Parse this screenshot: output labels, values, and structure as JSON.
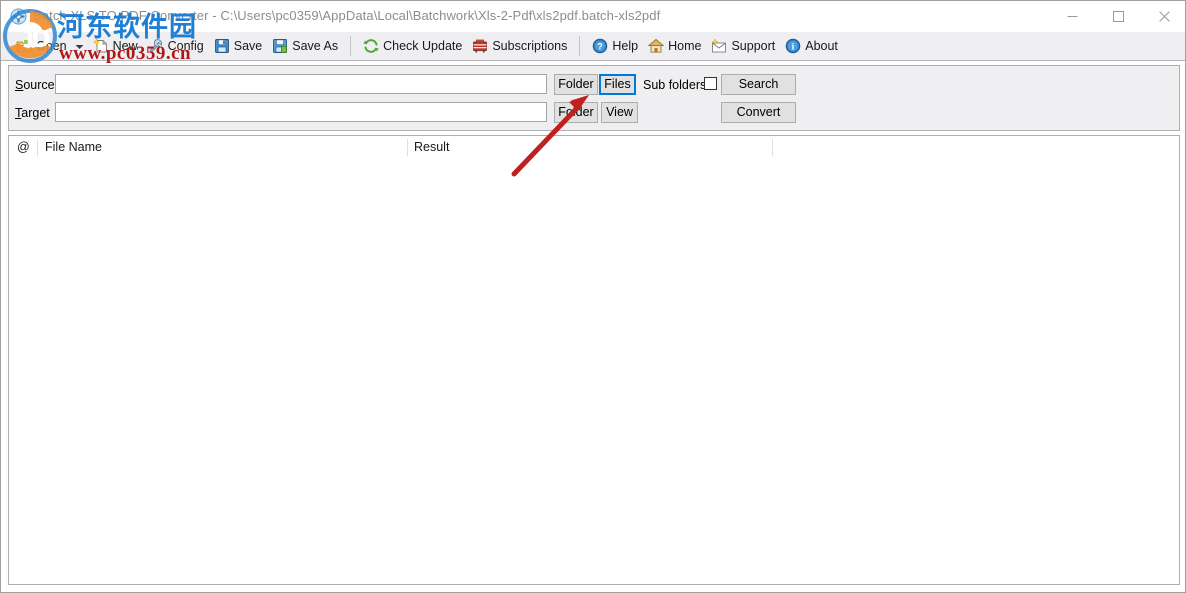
{
  "window": {
    "title_app": "Batch XLS TO PDF Converter",
    "title_separator": " - ",
    "title_path": "C:\\Users\\pc0359\\AppData\\Local\\Batchwork\\Xls-2-Pdf\\xls2pdf.batch-xls2pdf",
    "title_full": "Batch XLS TO PDF Converter - C:\\Users\\pc0359\\AppData\\Local\\Batchwork\\Xls-2-Pdf\\xls2pdf.batch-xls2pdf",
    "controls": {
      "minimize": "Minimize",
      "maximize": "Maximize",
      "close": "Close"
    }
  },
  "toolbar": {
    "items": [
      {
        "label": "Open",
        "icon": "open-folder-icon"
      },
      {
        "label": "New",
        "icon": "new-document-icon"
      },
      {
        "label": "Config",
        "icon": "config-tools-icon"
      },
      {
        "label": "Save",
        "icon": "save-disk-icon"
      },
      {
        "label": "Save As",
        "icon": "save-as-disk-icon"
      },
      {
        "label": "Check Update",
        "icon": "refresh-update-icon"
      },
      {
        "label": "Subscriptions",
        "icon": "subscriptions-cart-icon"
      },
      {
        "label": "Help",
        "icon": "help-question-icon"
      },
      {
        "label": "Home",
        "icon": "home-house-icon"
      },
      {
        "label": "Support",
        "icon": "support-mail-icon"
      },
      {
        "label": "About",
        "icon": "about-info-icon"
      }
    ]
  },
  "form": {
    "source": {
      "label_accel": "S",
      "label_rest": "ource",
      "value": "",
      "placeholder": "",
      "folder_button": "Folder",
      "files_button": "Files",
      "files_button_focused": true
    },
    "target": {
      "label_accel": "T",
      "label_rest": "arget",
      "value": "",
      "placeholder": "",
      "folder_button": "Folder",
      "view_button": "View"
    },
    "sub_folders": {
      "label": "Sub folders",
      "checked": false
    },
    "search_button": "Search",
    "convert_button": "Convert"
  },
  "list": {
    "columns": [
      {
        "key": "at",
        "label": "@"
      },
      {
        "key": "file_name",
        "label": "File Name"
      },
      {
        "key": "result",
        "label": "Result"
      },
      {
        "key": "extra",
        "label": ""
      }
    ],
    "rows": []
  },
  "watermark": {
    "chinese": "河东软件园",
    "url": "www.pc0359.cn"
  },
  "colors": {
    "accent": "#0078d7",
    "toolbar_bg": "#efeef0",
    "panel_bg": "#efeef0",
    "annotation_arrow": "#c0201e",
    "watermark_blue": "#1f7fd4",
    "watermark_red": "#b01818"
  }
}
